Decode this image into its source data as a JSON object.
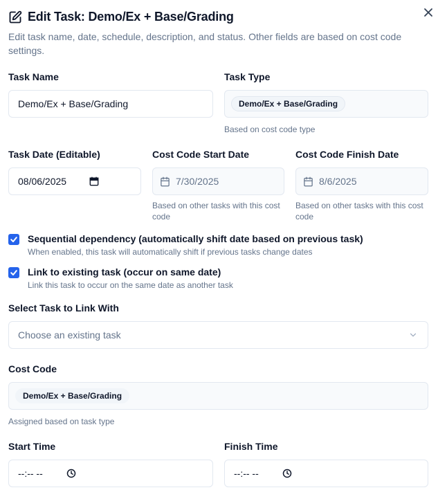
{
  "dialog": {
    "title": "Edit Task: Demo/Ex + Base/Grading",
    "subtitle": "Edit task name, date, schedule, description, and status. Other fields are based on cost code settings."
  },
  "task_name": {
    "label": "Task Name",
    "value": "Demo/Ex + Base/Grading"
  },
  "task_type": {
    "label": "Task Type",
    "value": "Demo/Ex + Base/Grading",
    "helper": "Based on cost code type"
  },
  "task_date": {
    "label": "Task Date (Editable)",
    "value": "08/06/2025"
  },
  "cost_code_start": {
    "label": "Cost Code Start Date",
    "value": "7/30/2025",
    "helper": "Based on other tasks with this cost code"
  },
  "cost_code_finish": {
    "label": "Cost Code Finish Date",
    "value": "8/6/2025",
    "helper": "Based on other tasks with this cost code"
  },
  "sequential": {
    "checked": true,
    "label": "Sequential dependency (automatically shift date based on previous task)",
    "description": "When enabled, this task will automatically shift if previous tasks change dates"
  },
  "link_task": {
    "checked": true,
    "label": "Link to existing task (occur on same date)",
    "description": "Link this task to occur on the same date as another task"
  },
  "select_link": {
    "label": "Select Task to Link With",
    "placeholder": "Choose an existing task"
  },
  "cost_code": {
    "label": "Cost Code",
    "value": "Demo/Ex + Base/Grading",
    "helper": "Assigned based on task type"
  },
  "start_time": {
    "label": "Start Time",
    "value": "--:-- --"
  },
  "finish_time": {
    "label": "Finish Time",
    "value": "--:-- --"
  },
  "colors": {
    "accent": "#2563eb",
    "muted_text": "#64748b",
    "border": "#e2e8f0",
    "disabled_bg": "#f8fafc"
  },
  "icons": {
    "edit": "edit-icon",
    "close": "close-icon",
    "calendar": "calendar-icon",
    "check": "check-icon",
    "chevron": "chevron-down-icon",
    "clock": "clock-icon"
  }
}
